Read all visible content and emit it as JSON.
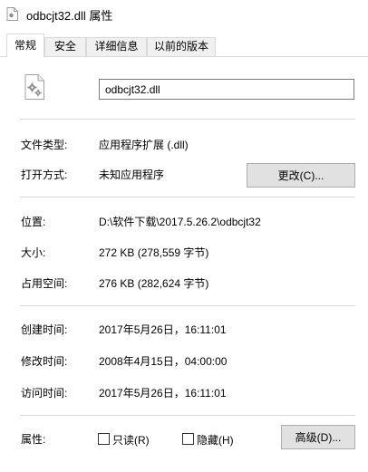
{
  "window": {
    "title": "odbcjt32.dll 属性"
  },
  "tabs": [
    {
      "label": "常规",
      "active": true
    },
    {
      "label": "安全",
      "active": false
    },
    {
      "label": "详细信息",
      "active": false
    },
    {
      "label": "以前的版本",
      "active": false
    }
  ],
  "general": {
    "file_icon": "dll-gear-file-icon",
    "file_name": "odbcjt32.dll",
    "file_type_label": "文件类型:",
    "file_type_value": "应用程序扩展 (.dll)",
    "opens_with_label": "打开方式:",
    "opens_with_value": "未知应用程序",
    "change_button": "更改(C)...",
    "location_label": "位置:",
    "location_value": "D:\\软件下载\\2017.5.26.2\\odbcjt32",
    "size_label": "大小:",
    "size_value": "272 KB (278,559 字节)",
    "size_on_disk_label": "占用空间:",
    "size_on_disk_value": "276 KB (282,624 字节)",
    "created_label": "创建时间:",
    "created_value": "2017年5月26日，16:11:01",
    "modified_label": "修改时间:",
    "modified_value": "2008年4月15日，04:00:00",
    "accessed_label": "访问时间:",
    "accessed_value": "2017年5月26日，16:11:01",
    "attributes_label": "属性:",
    "readonly_label": "只读(R)",
    "readonly_checked": false,
    "hidden_label": "隐藏(H)",
    "hidden_checked": false,
    "advanced_button": "高级(D)..."
  }
}
